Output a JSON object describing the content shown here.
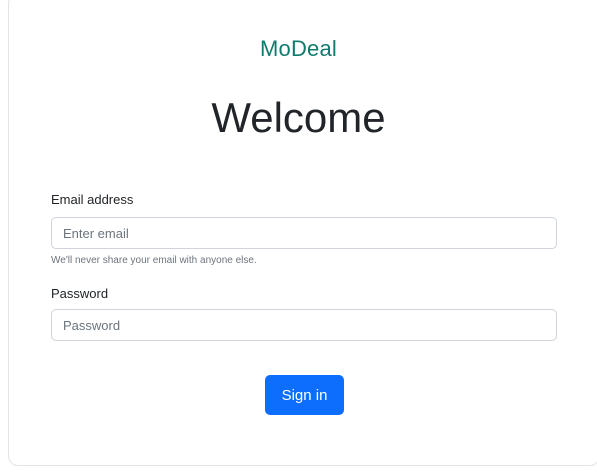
{
  "brand": "MoDeal",
  "heading": "Welcome",
  "form": {
    "email": {
      "label": "Email address",
      "placeholder": "Enter email",
      "value": "",
      "help": "We'll never share your email with anyone else."
    },
    "password": {
      "label": "Password",
      "placeholder": "Password",
      "value": ""
    },
    "submit_label": "Sign in"
  },
  "colors": {
    "brand": "#127a6c",
    "primary_button": "#0d6efd",
    "muted_text": "#6c757d",
    "input_border": "#ced4da"
  }
}
